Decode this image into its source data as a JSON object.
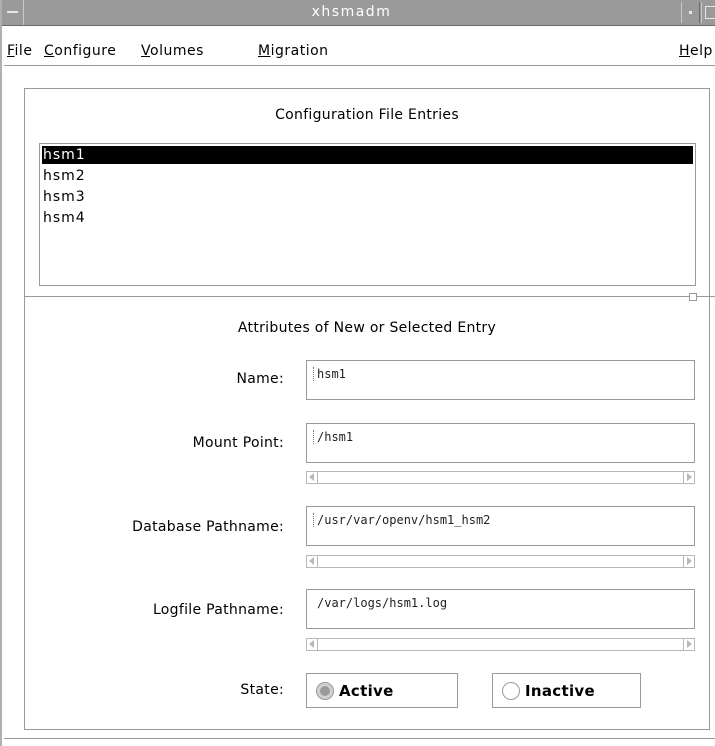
{
  "window": {
    "title": "xhsmadm"
  },
  "menubar": {
    "items": [
      {
        "mnemonic": "F",
        "rest": "ile"
      },
      {
        "mnemonic": "C",
        "rest": "onfigure"
      },
      {
        "mnemonic": "V",
        "rest": "olumes"
      },
      {
        "mnemonic": "M",
        "rest": "igration"
      }
    ],
    "help": {
      "mnemonic": "H",
      "rest": "elp"
    }
  },
  "entries": {
    "title": "Configuration File Entries",
    "items": [
      "hsm1",
      "hsm2",
      "hsm3",
      "hsm4"
    ],
    "selected": "hsm1"
  },
  "attributes": {
    "title": "Attributes of New or Selected Entry",
    "name_label": "Name:",
    "name_value": "hsm1",
    "mount_label": "Mount Point:",
    "mount_value": "/hsm1",
    "db_label": "Database Pathname:",
    "db_value": "/usr/var/openv/hsm1_hsm2",
    "log_label": "Logfile Pathname:",
    "log_value": "/var/logs/hsm1.log",
    "state_label": "State:",
    "state_options": [
      "Active",
      "Inactive"
    ],
    "state_selected": "Active"
  }
}
